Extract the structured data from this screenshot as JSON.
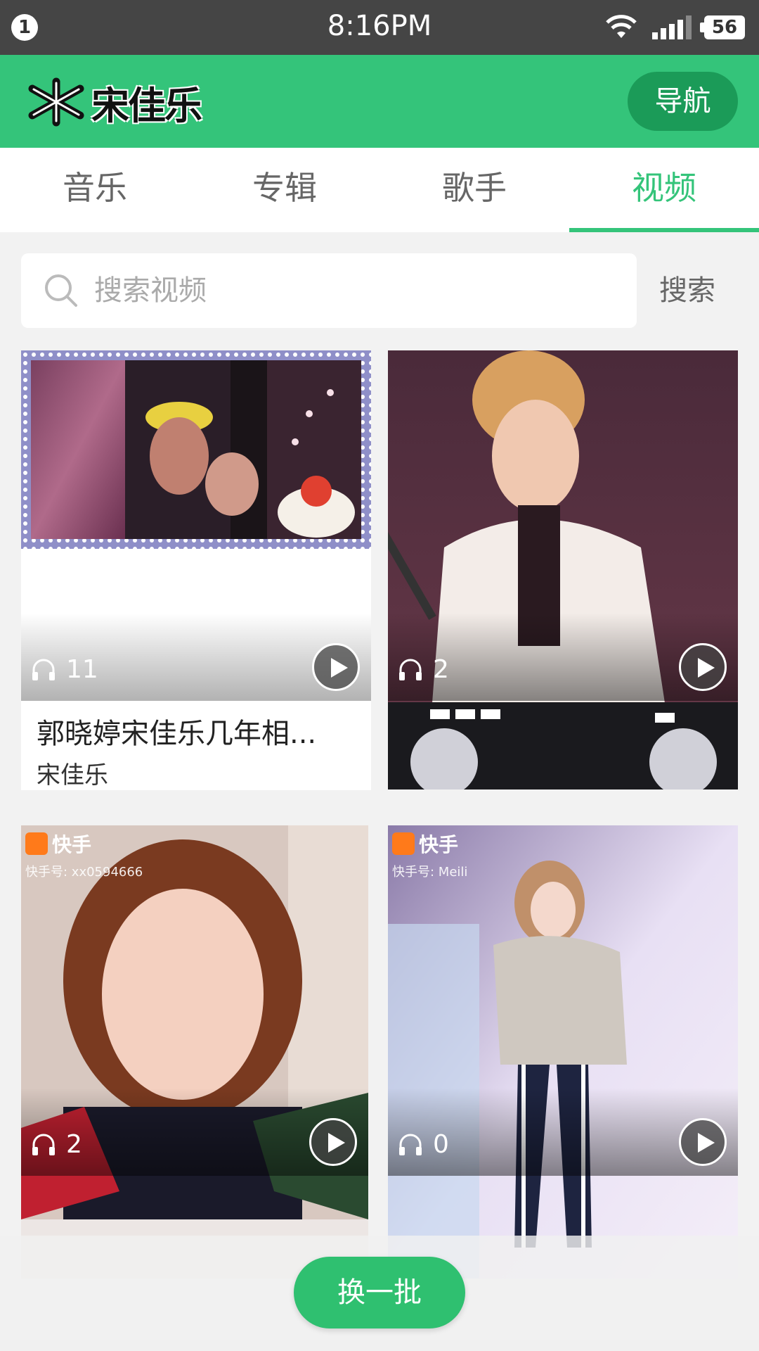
{
  "status_bar": {
    "notification_count": "1",
    "time": "8:16PM",
    "battery": "56",
    "icons": [
      "wifi-icon",
      "signal-icon",
      "battery-icon"
    ]
  },
  "header": {
    "logo_text": "宋佳乐",
    "nav_label": "导航",
    "accent_color": "#34c47a"
  },
  "tabs": [
    {
      "label": "音乐",
      "active": false
    },
    {
      "label": "专辑",
      "active": false
    },
    {
      "label": "歌手",
      "active": false
    },
    {
      "label": "视频",
      "active": true
    }
  ],
  "search": {
    "placeholder": "搜索视频",
    "value": "",
    "button_label": "搜索"
  },
  "videos": [
    {
      "title": "郭晓婷宋佳乐几年相...",
      "artist": "宋佳乐",
      "plays": "11"
    },
    {
      "title": "",
      "artist": "",
      "plays": "2"
    },
    {
      "title": "",
      "artist": "",
      "plays": "2",
      "source": "快手",
      "source_id": "快手号: xx0594666"
    },
    {
      "title": "",
      "artist": "",
      "plays": "0",
      "source": "快手",
      "source_id": "快手号: Meili"
    }
  ],
  "refresh_label": "换一批"
}
